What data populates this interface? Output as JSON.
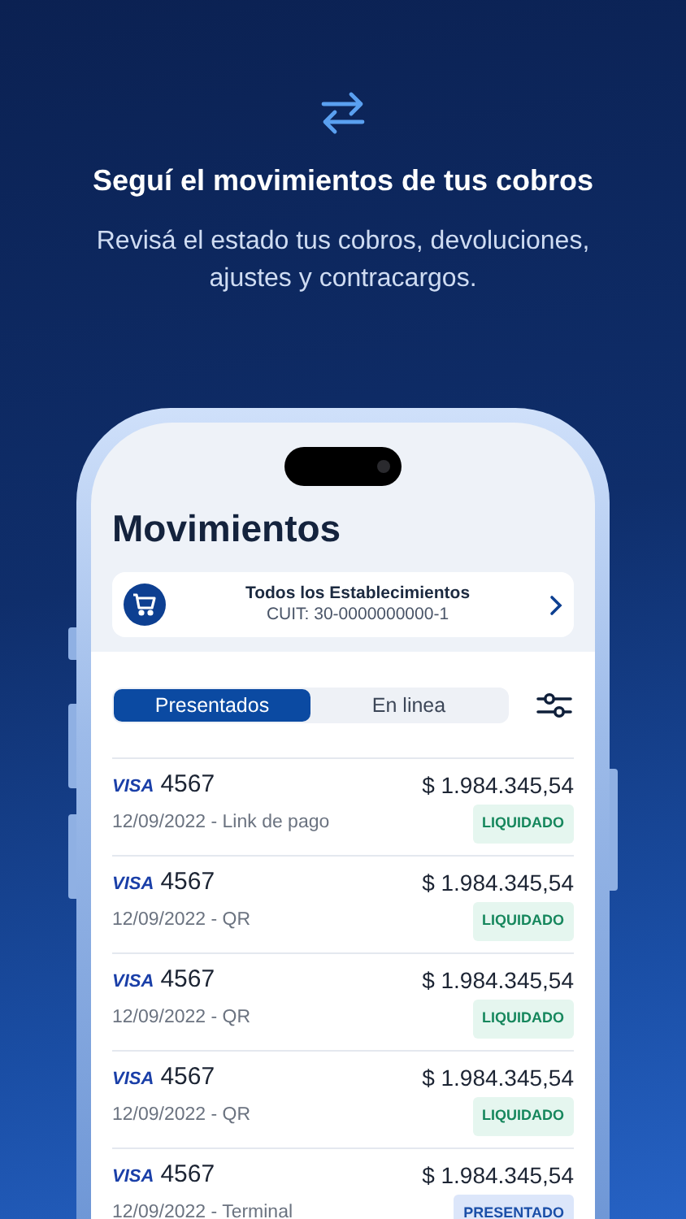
{
  "promo": {
    "title": "Seguí el movimientos de tus cobros",
    "subtitle": "Revisá el estado tus cobros, devoluciones, ajustes y contracargos."
  },
  "screen": {
    "title": "Movimientos",
    "merchant": {
      "name": "Todos los Establecimientos",
      "cuit": "CUIT: 30-0000000000-1"
    },
    "tabs": [
      {
        "label": "Presentados",
        "selected": true
      },
      {
        "label": "En linea",
        "selected": false
      }
    ],
    "movements": [
      {
        "brand": "VISA",
        "card": "4567",
        "amount": "$ 1.984.345,54",
        "detail": "12/09/2022 - Link de pago",
        "status": {
          "label": "LIQUIDADO",
          "kind": "liquidado"
        }
      },
      {
        "brand": "VISA",
        "card": "4567",
        "amount": "$ 1.984.345,54",
        "detail": "12/09/2022 - QR",
        "status": {
          "label": "LIQUIDADO",
          "kind": "liquidado"
        }
      },
      {
        "brand": "VISA",
        "card": "4567",
        "amount": "$ 1.984.345,54",
        "detail": "12/09/2022 - QR",
        "status": {
          "label": "LIQUIDADO",
          "kind": "liquidado"
        }
      },
      {
        "brand": "VISA",
        "card": "4567",
        "amount": "$ 1.984.345,54",
        "detail": "12/09/2022 - QR",
        "status": {
          "label": "LIQUIDADO",
          "kind": "liquidado"
        }
      },
      {
        "brand": "VISA",
        "card": "4567",
        "amount": "$ 1.984.345,54",
        "detail": "12/09/2022 - Terminal",
        "status": {
          "label": "PRESENTADO",
          "kind": "presentado"
        }
      }
    ]
  }
}
